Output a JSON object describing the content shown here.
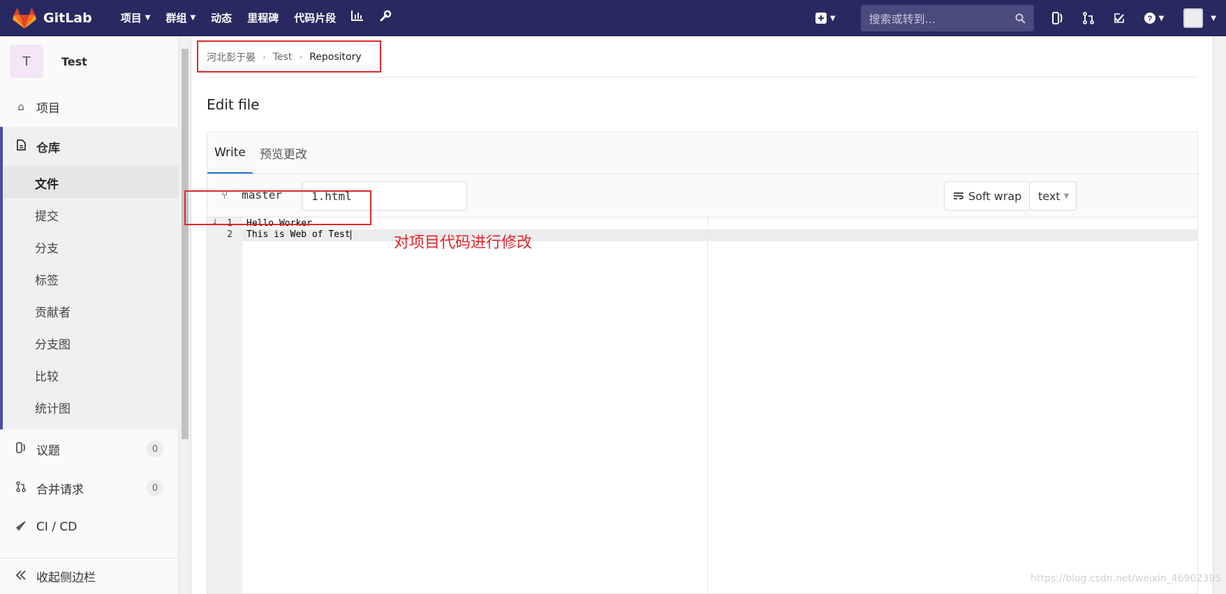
{
  "topnav": {
    "brand": "GitLab",
    "links": [
      "项目",
      "群组",
      "动态",
      "里程碑",
      "代码片段"
    ],
    "search_placeholder": "搜索或转到..."
  },
  "sidebar": {
    "project_initial": "T",
    "project_name": "Test",
    "items": {
      "project": "项目",
      "repository": "仓库",
      "files": "文件",
      "commits": "提交",
      "branches": "分支",
      "tags": "标签",
      "contributors": "贡献者",
      "graph": "分支图",
      "compare": "比较",
      "charts": "统计图",
      "issues": "议题",
      "issues_count": "0",
      "merge_requests": "合并请求",
      "merge_requests_count": "0",
      "ci_cd": "CI / CD",
      "collapse": "收起侧边栏"
    }
  },
  "breadcrumb": [
    "河北彭于晏",
    "Test",
    "Repository"
  ],
  "page_title": "Edit file",
  "editor": {
    "tabs": [
      "Write",
      "预览更改"
    ],
    "branch": "master",
    "file_name": "1.html",
    "soft_wrap": "Soft wrap",
    "mode": "text",
    "lines": [
      {
        "num": "1",
        "text": "Hello Worker"
      },
      {
        "num": "2",
        "text": "This is Web of Test"
      }
    ]
  },
  "annotation": "对项目代码进行修改",
  "watermark": "https://blog.csdn.net/weixin_46902395",
  "colors": {
    "nav_bg": "#292961",
    "accent": "#4b4ba3",
    "highlight": "#e0262a"
  }
}
